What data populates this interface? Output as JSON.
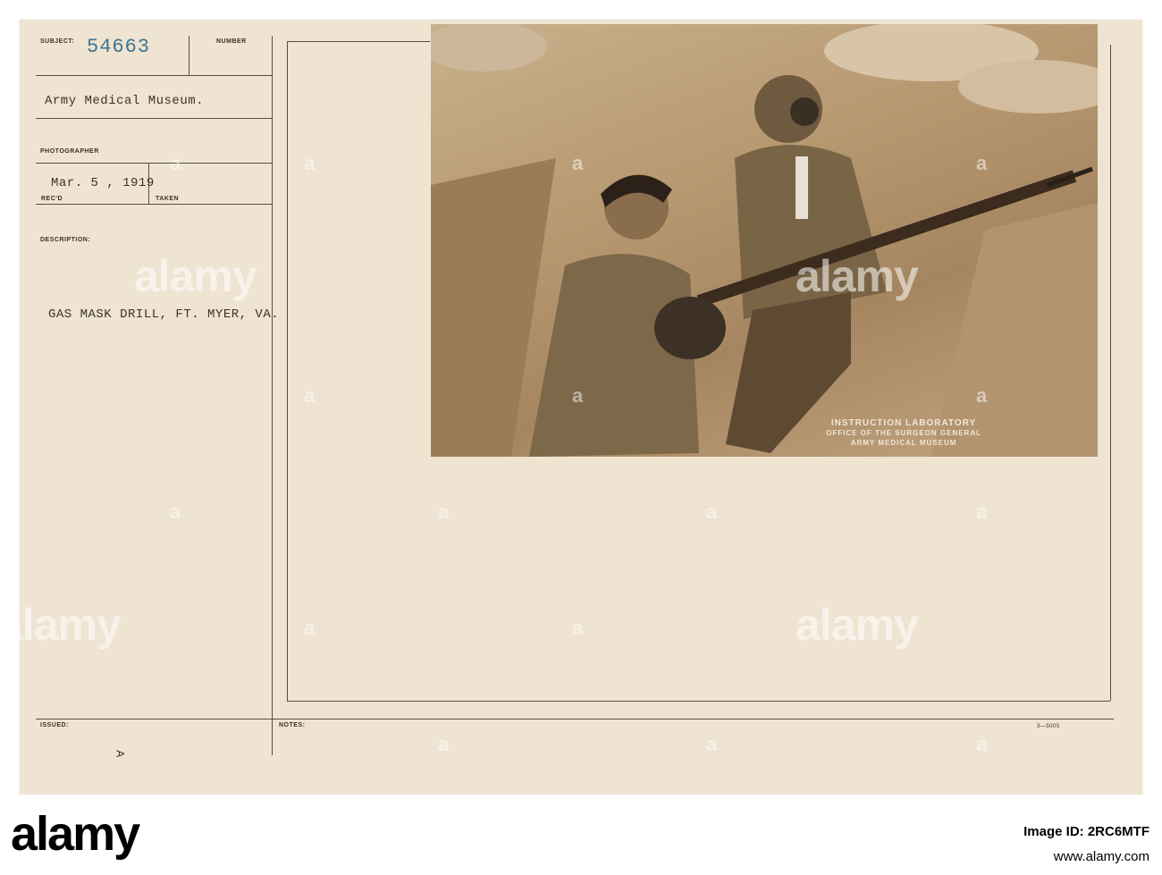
{
  "card": {
    "subject_label": "SUBJECT:",
    "subject_number": "54663",
    "number_label": "NUMBER",
    "source": "Army Medical Museum.",
    "photographer_label": "PHOTOGRAPHER",
    "date": "Mar. 5 , 1919",
    "recd_label": "REC'D",
    "taken_label": "TAKEN",
    "description_label": "DESCRIPTION:",
    "description": "GAS MASK DRILL, FT. MYER, VA.",
    "issued_label": "ISSUED:",
    "issued_mark": "A",
    "notes_label": "NOTES:",
    "form_number": "3—5005"
  },
  "photo": {
    "caption_lines": [
      "INSTRUCTION LABORATORY",
      "OFFICE OF THE SURGEON GENERAL",
      "ARMY MEDICAL MUSEUM"
    ]
  },
  "watermark": {
    "text": "alamy",
    "glyph": "a"
  },
  "footer": {
    "logo": "alamy",
    "image_id_label": "Image ID: 2RC6MTF",
    "url": "www.alamy.com"
  }
}
